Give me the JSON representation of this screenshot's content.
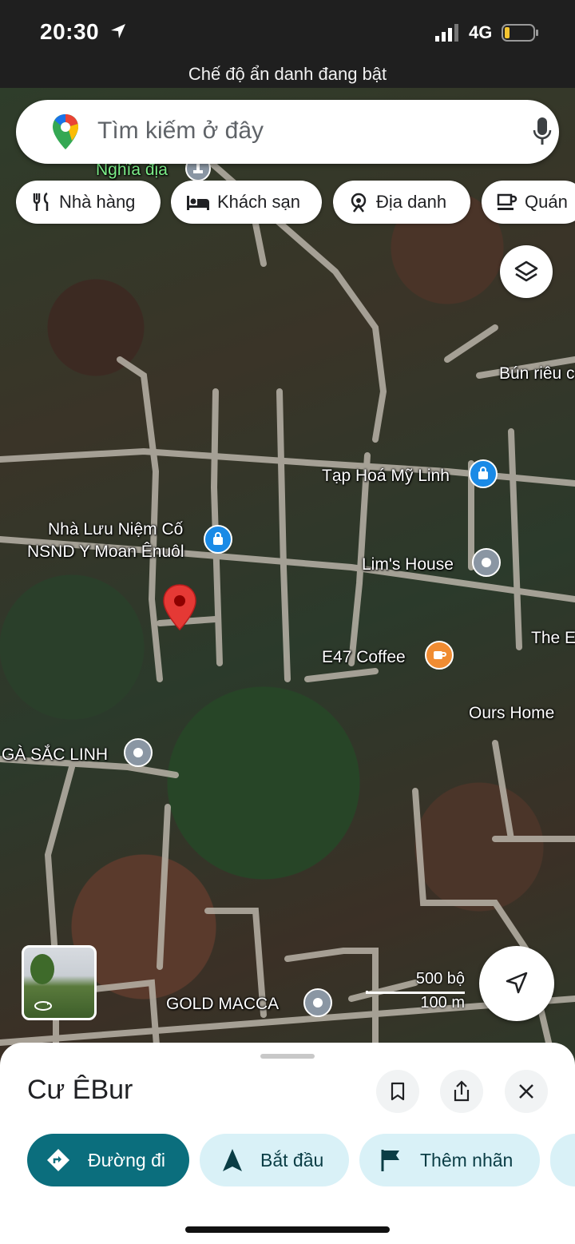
{
  "status_bar": {
    "time": "20:30",
    "network": "4G"
  },
  "incognito_banner": "Chế độ ẩn danh đang bật",
  "search": {
    "placeholder": "Tìm kiếm ở đây"
  },
  "chips": [
    {
      "label": "Nhà hàng",
      "icon": "restaurant-icon"
    },
    {
      "label": "Khách sạn",
      "icon": "hotel-icon"
    },
    {
      "label": "Địa danh",
      "icon": "landmark-icon"
    },
    {
      "label": "Quán",
      "icon": "cafe-icon"
    }
  ],
  "map_labels": {
    "cemetery": "Nghĩa địa",
    "bun_rieu": "Bún riêu c",
    "tap_hoa": "Tạp Hoá Mỹ Linh",
    "nha_luu_niem_1": "Nhà Lưu Niệm Cố",
    "nha_luu_niem_2": "NSND Y Moan Ênuôl",
    "lims_house": "Lim's House",
    "the_e": "The E",
    "e47": "E47 Coffee",
    "ours_home": "Ours Home",
    "ga_sac_linh": "GÀ SẮC LINH",
    "gold_macca": "GOLD MACCA"
  },
  "scale": {
    "imperial": "500 bộ",
    "metric": "100 m"
  },
  "sheet": {
    "title": "Cư ÊBur",
    "actions": [
      {
        "label": "Đường đi"
      },
      {
        "label": "Bắt đầu"
      },
      {
        "label": "Thêm nhãn"
      }
    ]
  },
  "colors": {
    "primary": "#0b6e7d",
    "secondary_bg": "#d9f1f7",
    "pin_red": "#e53935",
    "pin_blue": "#1a8ae6",
    "pin_orange": "#f08c32"
  }
}
